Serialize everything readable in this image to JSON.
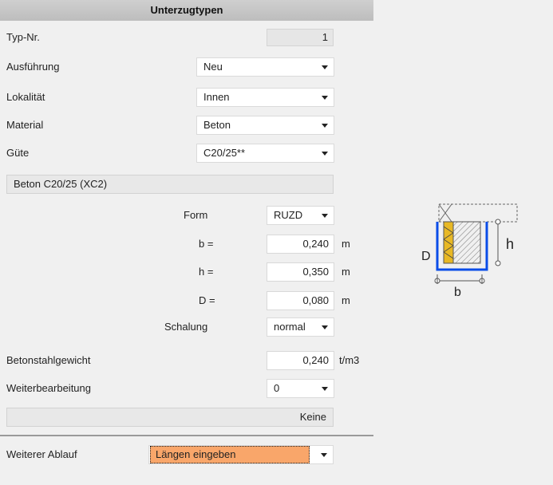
{
  "header": {
    "title": "Unterzugtypen"
  },
  "typ_nr": {
    "label": "Typ-Nr.",
    "value": "1"
  },
  "ausfuehrung": {
    "label": "Ausführung",
    "value": "Neu"
  },
  "lokalitaet": {
    "label": "Lokalität",
    "value": "Innen"
  },
  "material": {
    "label": "Material",
    "value": "Beton"
  },
  "guete": {
    "label": "Güte",
    "value": "C20/25**"
  },
  "material_summary": "Beton C20/25 (XC2)",
  "form": {
    "label": "Form",
    "value": "RUZD"
  },
  "b": {
    "label": "b =",
    "value": "0,240",
    "unit": "m"
  },
  "h": {
    "label": "h =",
    "value": "0,350",
    "unit": "m"
  },
  "d": {
    "label": "D =",
    "value": "0,080",
    "unit": "m"
  },
  "schalung": {
    "label": "Schalung",
    "value": "normal"
  },
  "betonstahlgewicht": {
    "label": "Betonstahlgewicht",
    "value": "0,240",
    "unit": "t/m3"
  },
  "weiterbearbeitung": {
    "label": "Weiterbearbeitung",
    "value": "0",
    "status": "Keine"
  },
  "weiterer_ablauf": {
    "label": "Weiterer Ablauf",
    "value": "Längen eingeben"
  },
  "diagram": {
    "label_d": "D",
    "label_h": "h",
    "label_b": "b"
  }
}
